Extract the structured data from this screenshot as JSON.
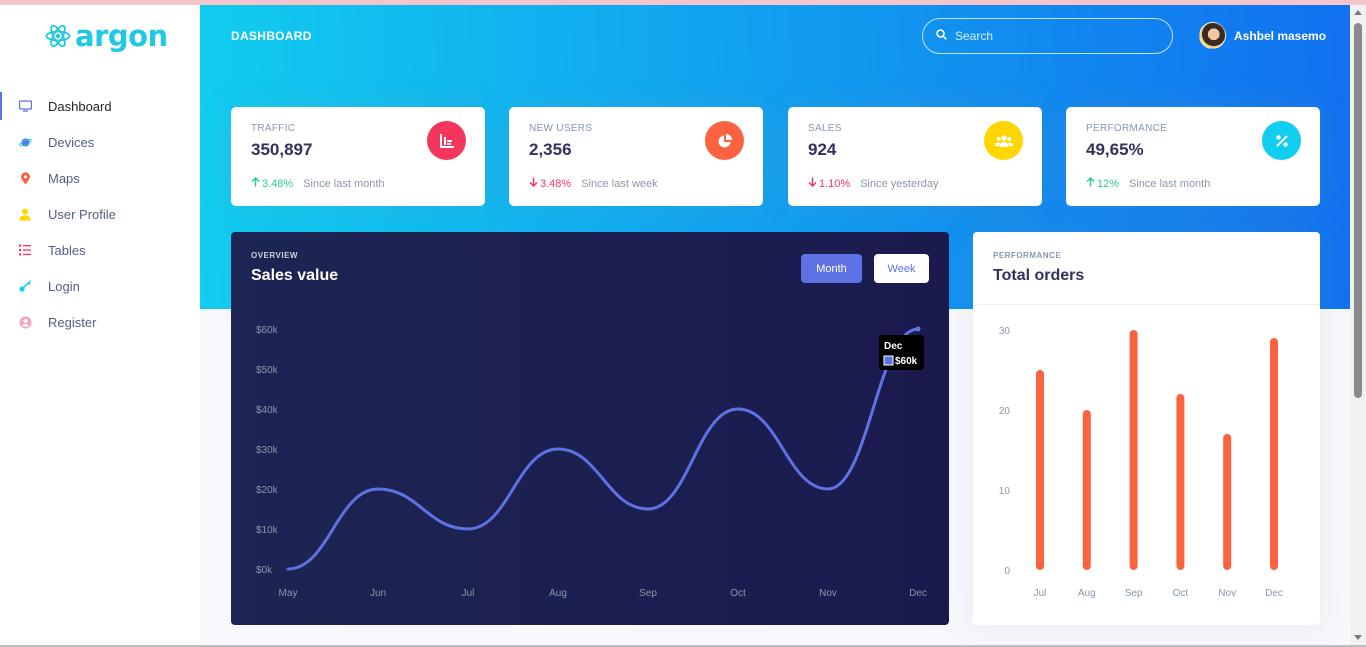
{
  "brand": {
    "name": "argon"
  },
  "header": {
    "title": "DASHBOARD",
    "search_placeholder": "Search",
    "user_name": "Ashbel masemo"
  },
  "sidebar": {
    "items": [
      {
        "label": "Dashboard",
        "icon": "tv-icon",
        "color": "#5e72e4",
        "active": true
      },
      {
        "label": "Devices",
        "icon": "planet-icon",
        "color": "#5e72e4"
      },
      {
        "label": "Maps",
        "icon": "pin-icon",
        "color": "#fb6340"
      },
      {
        "label": "User Profile",
        "icon": "single-user-icon",
        "color": "#ffd600"
      },
      {
        "label": "Tables",
        "icon": "bullet-list-icon",
        "color": "#f5365c"
      },
      {
        "label": "Login",
        "icon": "key-icon",
        "color": "#11cdef"
      },
      {
        "label": "Register",
        "icon": "circle-user-icon",
        "color": "#f3a4b5"
      }
    ]
  },
  "stats": [
    {
      "label": "TRAFFIC",
      "value": "350,897",
      "change": "3.48%",
      "direction": "up",
      "since": "Since last month",
      "icon": "chart-bar-icon",
      "color": "#f5365c"
    },
    {
      "label": "NEW USERS",
      "value": "2,356",
      "change": "3.48%",
      "direction": "down",
      "since": "Since last week",
      "icon": "chart-pie-icon",
      "color": "#fb6340"
    },
    {
      "label": "SALES",
      "value": "924",
      "change": "1.10%",
      "direction": "down",
      "since": "Since yesterday",
      "icon": "users-icon",
      "color": "#ffd600"
    },
    {
      "label": "PERFORMANCE",
      "value": "49,65%",
      "change": "12%",
      "direction": "up",
      "since": "Since last month",
      "icon": "percent-icon",
      "color": "#11cdef"
    }
  ],
  "sales_card": {
    "overline": "OVERVIEW",
    "title": "Sales value",
    "btn_month": "Month",
    "btn_week": "Week",
    "tooltip_label": "Dec",
    "tooltip_value": "$60k"
  },
  "orders_card": {
    "overline": "PERFORMANCE",
    "title": "Total orders"
  },
  "chart_data": [
    {
      "type": "line",
      "categories": [
        "May",
        "Jun",
        "Jul",
        "Aug",
        "Sep",
        "Oct",
        "Nov",
        "Dec"
      ],
      "values": [
        0,
        20,
        10,
        30,
        15,
        40,
        20,
        60
      ],
      "yticks": [
        "$0k",
        "$10k",
        "$20k",
        "$30k",
        "$40k",
        "$50k",
        "$60k"
      ],
      "ylim": [
        0,
        60
      ],
      "color": "#5e72e4"
    },
    {
      "type": "bar",
      "categories": [
        "Jul",
        "Aug",
        "Sep",
        "Oct",
        "Nov",
        "Dec"
      ],
      "values": [
        25,
        20,
        30,
        22,
        17,
        29
      ],
      "yticks": [
        "0",
        "10",
        "20",
        "30"
      ],
      "ylim": [
        0,
        30
      ],
      "color": "#fb6340"
    }
  ]
}
